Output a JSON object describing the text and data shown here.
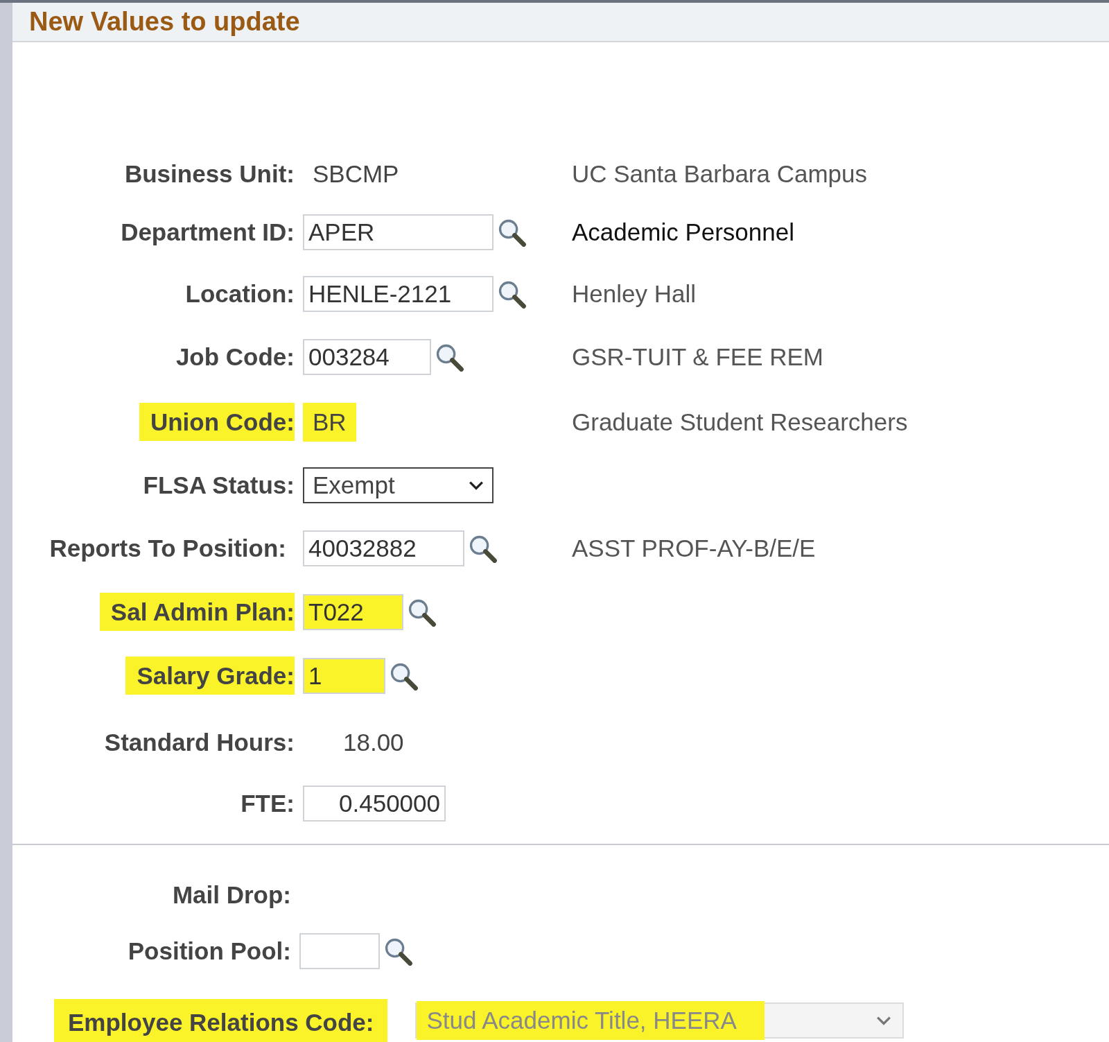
{
  "section": {
    "title": "New Values to update"
  },
  "fields": [
    {
      "label": "Business Unit:",
      "kind": "display",
      "value": "SBCMP",
      "description": "UC Santa Barbara Campus",
      "lookup": false,
      "highlighted": false
    },
    {
      "label": "Department ID:",
      "kind": "input",
      "value": "APER",
      "description": "Academic Personnel",
      "lookup": true,
      "highlighted": false
    },
    {
      "label": "Location:",
      "kind": "input",
      "value": "HENLE-2121",
      "description": "Henley Hall",
      "lookup": true,
      "highlighted": false
    },
    {
      "label": "Job Code:",
      "kind": "input",
      "value": "003284",
      "description": "GSR-TUIT & FEE REM",
      "lookup": true,
      "highlighted": false
    },
    {
      "label": "Union Code:",
      "kind": "display",
      "value": "BR",
      "description": "Graduate Student Researchers",
      "lookup": false,
      "highlighted": true
    },
    {
      "label": "FLSA Status:",
      "kind": "select",
      "value": "Exempt",
      "lookup": false,
      "highlighted": false
    },
    {
      "label": "Reports To Position:",
      "kind": "input",
      "value": "40032882",
      "description": "ASST PROF-AY-B/E/E",
      "lookup": true,
      "highlighted": false
    },
    {
      "label": "Sal Admin Plan:",
      "kind": "input",
      "value": "T022",
      "lookup": true,
      "highlighted": true
    },
    {
      "label": "Salary Grade:",
      "kind": "input",
      "value": "1",
      "lookup": true,
      "highlighted": true
    },
    {
      "label": "Standard Hours:",
      "kind": "display",
      "value": "18.00",
      "lookup": false,
      "highlighted": false
    },
    {
      "label": "FTE:",
      "kind": "input",
      "value": "0.450000",
      "lookup": false,
      "highlighted": false
    }
  ],
  "lower_fields": [
    {
      "label": "Mail Drop:",
      "kind": "display",
      "lookup": false,
      "highlighted": false
    },
    {
      "label": "Position Pool:",
      "kind": "input",
      "lookup": true,
      "highlighted": false
    }
  ],
  "employee_relations": {
    "label": "Employee Relations Code:",
    "value": "Stud Academic Title, HEERA",
    "disabled": true,
    "highlighted": true
  }
}
